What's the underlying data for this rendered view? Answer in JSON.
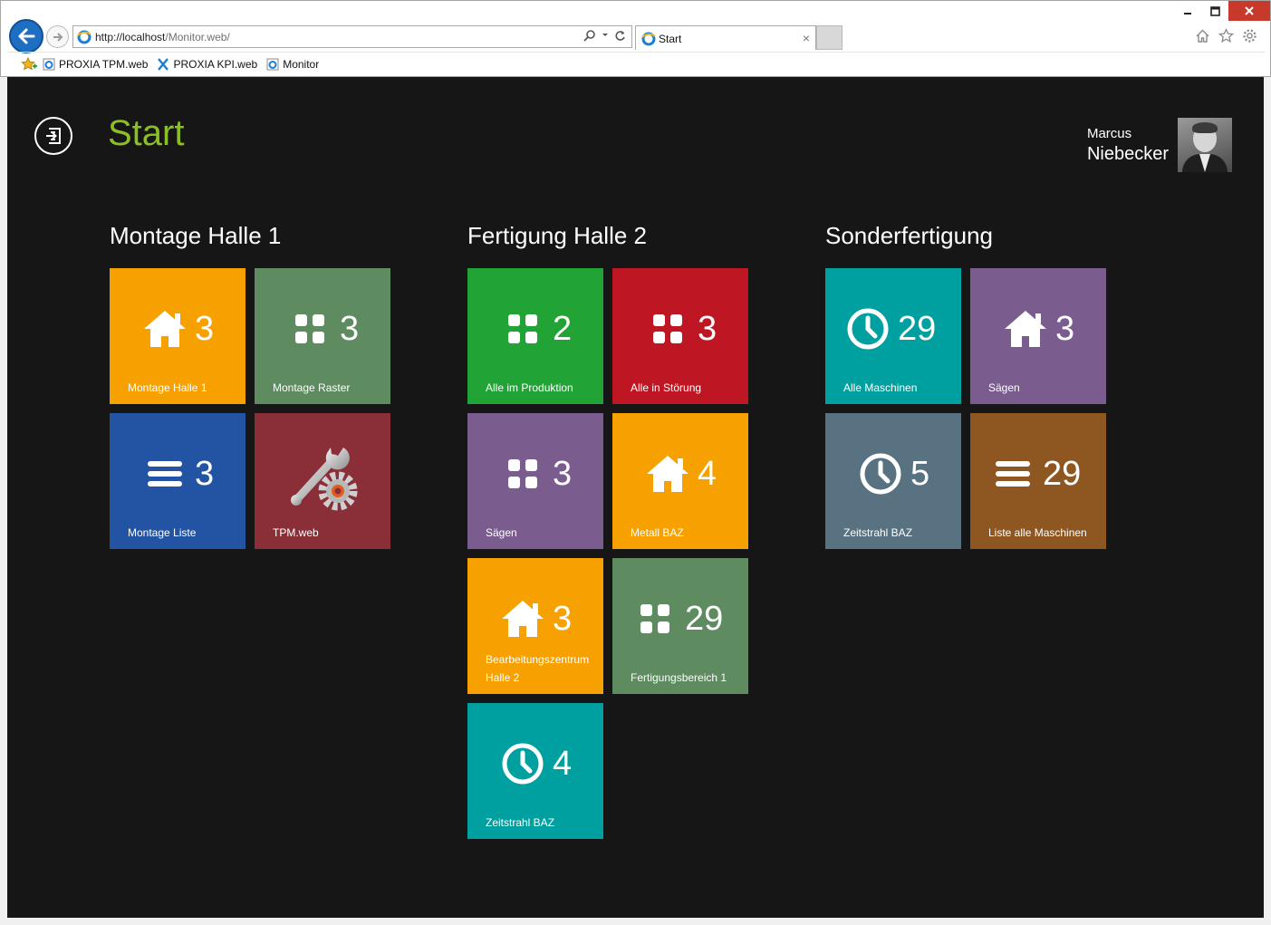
{
  "browser": {
    "url_host": "http://localhost",
    "url_path": "/Monitor.web/",
    "tab_title": "Start",
    "tab_close": "×",
    "favorites": [
      {
        "label": "PROXIA TPM.web"
      },
      {
        "label": "PROXIA KPI.web"
      },
      {
        "label": "Monitor"
      }
    ]
  },
  "header": {
    "title": "Start",
    "user_first": "Marcus",
    "user_last": "Niebecker"
  },
  "groups": [
    {
      "title": "Montage Halle 1",
      "tiles": [
        {
          "label": "Montage Halle 1",
          "count": "3",
          "icon": "home-icon",
          "color": "#f7a100"
        },
        {
          "label": "Montage Raster",
          "count": "3",
          "icon": "grid-icon",
          "color": "#5e8b5f"
        },
        {
          "label": "Montage Liste",
          "count": "3",
          "icon": "list-icon",
          "color": "#2254a3"
        },
        {
          "label": "TPM.web",
          "count": "",
          "icon": "wrench-gear-icon",
          "color": "#8a2f37"
        }
      ]
    },
    {
      "title": "Fertigung Halle 2",
      "tiles": [
        {
          "label": "Alle im Produktion",
          "count": "2",
          "icon": "grid-icon",
          "color": "#21a335"
        },
        {
          "label": "Alle in Störung",
          "count": "3",
          "icon": "grid-icon",
          "color": "#be1622"
        },
        {
          "label": "Sägen",
          "count": "3",
          "icon": "grid-icon",
          "color": "#7a5c8f"
        },
        {
          "label": "Metall BAZ",
          "count": "4",
          "icon": "home-icon",
          "color": "#f7a100"
        },
        {
          "label": "Bearbeitungszentrum Halle 2",
          "count": "3",
          "icon": "home-icon",
          "color": "#f7a100"
        },
        {
          "label": "Fertigungsbereich 1",
          "count": "29",
          "icon": "grid-icon",
          "color": "#5e8b5f"
        },
        {
          "label": "Zeitstrahl BAZ",
          "count": "4",
          "icon": "clock-icon",
          "color": "#00a0a0"
        }
      ]
    },
    {
      "title": "Sonderfertigung",
      "tiles": [
        {
          "label": "Alle Maschinen",
          "count": "29",
          "icon": "clock-icon",
          "color": "#00a0a0"
        },
        {
          "label": "Sägen",
          "count": "3",
          "icon": "home-icon",
          "color": "#7a5c8f"
        },
        {
          "label": "Zeitstrahl BAZ",
          "count": "5",
          "icon": "clock-icon",
          "color": "#587281"
        },
        {
          "label": "Liste alle Maschinen",
          "count": "29",
          "icon": "list-icon",
          "color": "#8e5620"
        }
      ]
    }
  ]
}
